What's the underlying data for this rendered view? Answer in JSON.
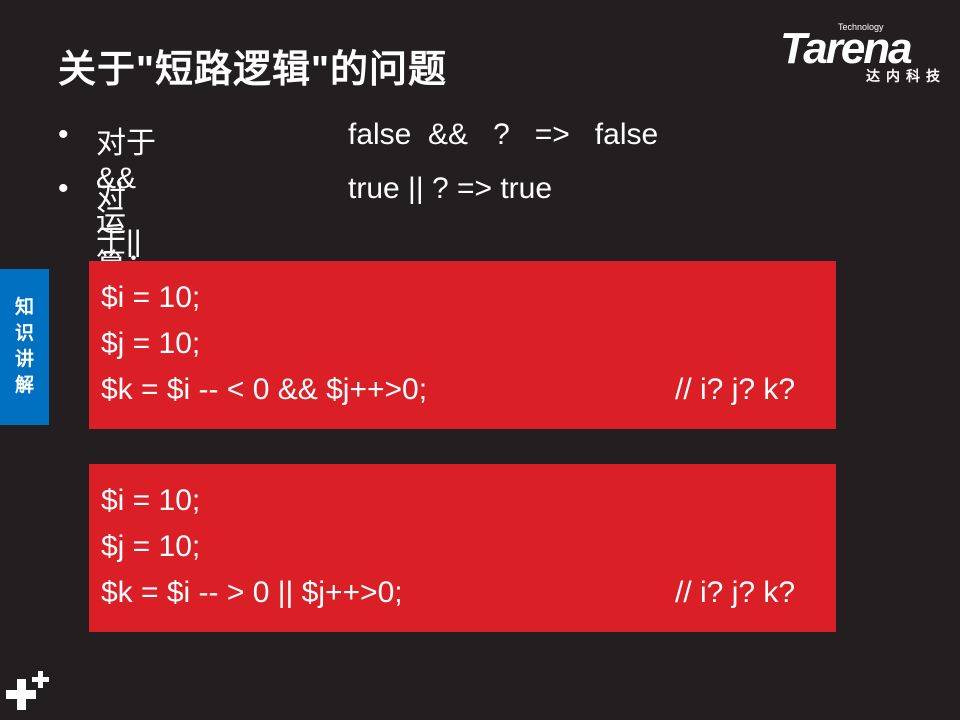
{
  "title": "关于\"短路逻辑\"的问题",
  "logo": {
    "tech": "Technology",
    "name": "Tarena",
    "cn": "达内科技"
  },
  "bullets": [
    {
      "dot": "•",
      "label": "对于&&运算：",
      "expr": "false  &&   ?   =>   false"
    },
    {
      "dot": "•",
      "label": "对于||运算：",
      "expr": "true || ? => true"
    }
  ],
  "side_tab": [
    "知",
    "识",
    "讲",
    "解"
  ],
  "code_blocks": [
    {
      "lines": [
        "$i = 10;",
        "$j = 10;",
        "$k = $i -- < 0 && $j++>0;"
      ],
      "comment": "// i? j? k?"
    },
    {
      "lines": [
        "$i = 10;",
        "$j = 10;",
        "$k = $i -- > 0 || $j++>0;"
      ],
      "comment": "// i? j? k?"
    }
  ]
}
